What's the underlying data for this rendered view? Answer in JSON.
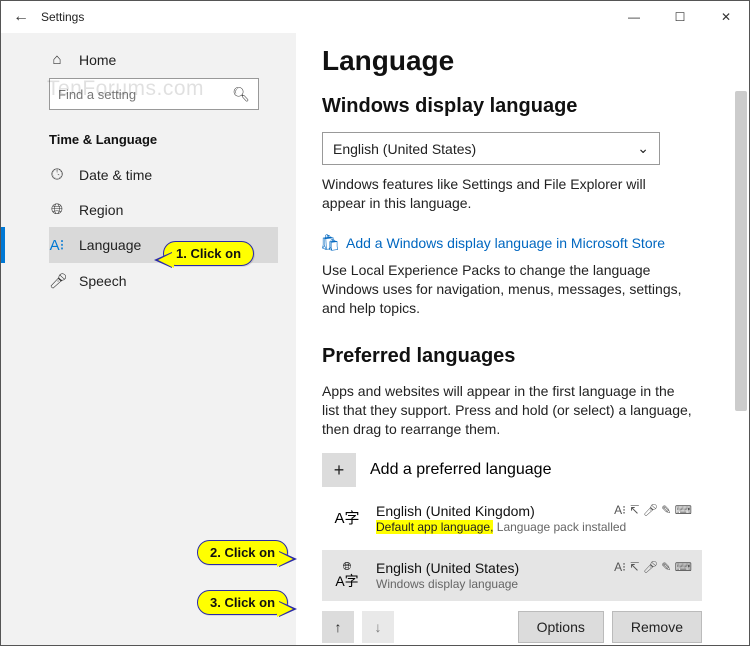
{
  "titlebar": {
    "back_icon": "←",
    "title": "Settings",
    "minimize": "—",
    "maximize": "☐",
    "close": "✕"
  },
  "sidebar": {
    "home_label": "Home",
    "search_placeholder": "Find a setting",
    "category": "Time & Language",
    "items": [
      {
        "icon": "date-time-icon",
        "label": "Date & time"
      },
      {
        "icon": "region-icon",
        "label": "Region"
      },
      {
        "icon": "language-icon",
        "label": "Language"
      },
      {
        "icon": "speech-icon",
        "label": "Speech"
      }
    ]
  },
  "main": {
    "h1": "Language",
    "display_section_title": "Windows display language",
    "display_dropdown_value": "English (United States)",
    "display_desc": "Windows features like Settings and File Explorer will appear in this language.",
    "store_link": "Add a Windows display language in Microsoft Store",
    "store_desc": "Use Local Experience Packs to change the language Windows uses for navigation, menus, messages, settings, and help topics.",
    "preferred_title": "Preferred languages",
    "preferred_desc": "Apps and websites will appear in the first language in the list that they support. Press and hold (or select) a language, then drag to rearrange them.",
    "add_label": "Add a preferred language",
    "langs": [
      {
        "name": "English (United Kingdom)",
        "sub_hl": "Default app language,",
        "sub_rest": " Language pack installed"
      },
      {
        "name": "English (United States)",
        "sub_hl": "",
        "sub_rest": "Windows display language"
      }
    ],
    "options_label": "Options",
    "remove_label": "Remove"
  },
  "callouts": {
    "c1": "1. Click on",
    "c2": "2. Click on",
    "c3": "3. Click on"
  },
  "watermark": "TenForums.com"
}
